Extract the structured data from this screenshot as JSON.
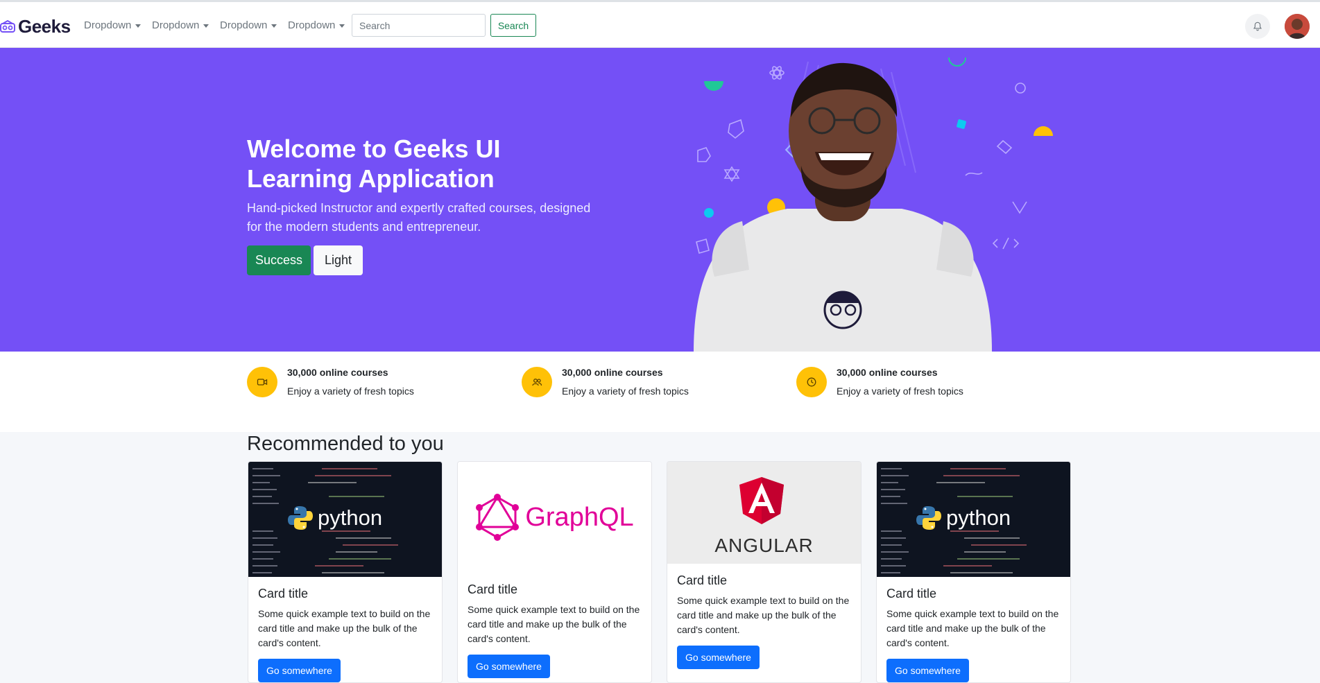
{
  "navbar": {
    "brand": "Geeks",
    "dropdowns": [
      "Dropdown",
      "Dropdown",
      "Dropdown",
      "Dropdown"
    ],
    "search_placeholder": "Search",
    "search_button": "Search",
    "icons": [
      "bell-icon",
      "user-avatar"
    ]
  },
  "hero": {
    "title": "Welcome to Geeks UI Learning Application",
    "subtitle": "Hand-picked Instructor and expertly crafted courses, designed for the modern students and entrepreneur.",
    "primary_button": "Success",
    "secondary_button": "Light",
    "background_color": "#7450f6"
  },
  "features": [
    {
      "icon": "video-icon",
      "title": "30,000 online courses",
      "subtitle": "Enjoy a variety of fresh topics"
    },
    {
      "icon": "users-icon",
      "title": "30,000 online courses",
      "subtitle": "Enjoy a variety of fresh topics"
    },
    {
      "icon": "clock-icon",
      "title": "30,000 online courses",
      "subtitle": "Enjoy a variety of fresh topics"
    }
  ],
  "recommended": {
    "title": "Recommended to you",
    "cards": [
      {
        "image": "python",
        "image_text": "python",
        "title": "Card title",
        "text": "Some quick example text to build on the card title and make up the bulk of the card's content.",
        "button": "Go somewhere"
      },
      {
        "image": "graphql",
        "image_text": "GraphQL",
        "title": "Card title",
        "text": "Some quick example text to build on the card title and make up the bulk of the card's content.",
        "button": "Go somewhere"
      },
      {
        "image": "angular",
        "image_text": "ANGULAR",
        "title": "Card title",
        "text": "Some quick example text to build on the card title and make up the bulk of the card's content.",
        "button": "Go somewhere"
      },
      {
        "image": "python",
        "image_text": "python",
        "title": "Card title",
        "text": "Some quick example text to build on the card title and make up the bulk of the card's content.",
        "button": "Go somewhere"
      }
    ]
  },
  "colors": {
    "accent_yellow": "#ffc107",
    "success": "#198754",
    "primary": "#0d6efd"
  }
}
